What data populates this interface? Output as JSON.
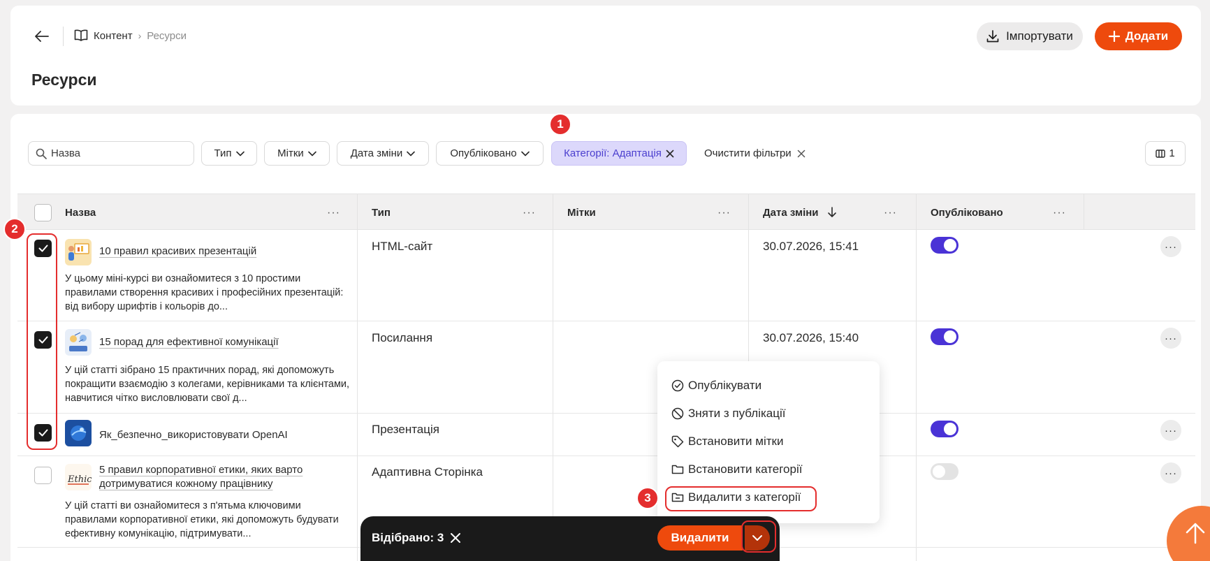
{
  "header": {
    "breadcrumb_root": "Контент",
    "breadcrumb_current": "Ресурси",
    "page_title": "Ресурси",
    "import_label": "Імпортувати",
    "add_label": "Додати"
  },
  "filters": {
    "search_placeholder": "Назва",
    "type_label": "Тип",
    "tags_label": "Мітки",
    "date_label": "Дата зміни",
    "published_label": "Опубліковано",
    "category_label": "Категорії: Адаптація",
    "clear_label": "Очистити фільтри",
    "columns_count": "1"
  },
  "table": {
    "columns": {
      "name": "Назва",
      "type": "Тип",
      "tags": "Мітки",
      "date": "Дата зміни",
      "published": "Опубліковано"
    },
    "rows": [
      {
        "title": "10 правил красивих презентацій",
        "description": "У цьому міні-курсі ви ознайомитеся з 10 простими правилами створення красивих і професійних презентацій: від вибору шрифтів і кольорів до...",
        "type": "HTML-сайт",
        "date": "30.07.2026, 15:41",
        "published": true,
        "selected": true
      },
      {
        "title": "15 порад для ефективної комунікації",
        "description": "У цій статті зібрано 15 практичних порад, які допоможуть покращити взаємодію з колегами, керівниками та клієнтами, навчитися чітко висловлювати свої д...",
        "type": "Посилання",
        "date": "30.07.2026, 15:40",
        "published": true,
        "selected": true
      },
      {
        "title": "Як_безпечно_використовувати OpenAI",
        "description": "",
        "type": "Презентація",
        "date": "",
        "published": true,
        "selected": true
      },
      {
        "title": "5 правил корпоративної етики, яких варто дотримуватися кожному працівнику",
        "description": "У цій статті ви ознайомитеся з п'ятьма ключовими правилами корпоративної етики, які допоможуть будувати ефективну комунікацію, підтримувати...",
        "type": "Адаптивна Сторінка",
        "date": "",
        "published": false,
        "selected": false
      }
    ]
  },
  "bulk_menu": {
    "publish": "Опублікувати",
    "unpublish": "Зняти з публікації",
    "set_tags": "Встановити мітки",
    "set_categories": "Встановити категорії",
    "remove_from_category": "Видалити з категорії"
  },
  "bulk_bar": {
    "selected_label": "Відібрано: 3",
    "delete_label": "Видалити"
  },
  "annotations": {
    "badge1": "1",
    "badge2": "2",
    "badge3": "3"
  },
  "colors": {
    "accent": "#ee4a0d",
    "toggle_on": "#4a33d6",
    "annotation_red": "#e42d2d",
    "active_filter_bg": "#dcd8fb"
  }
}
